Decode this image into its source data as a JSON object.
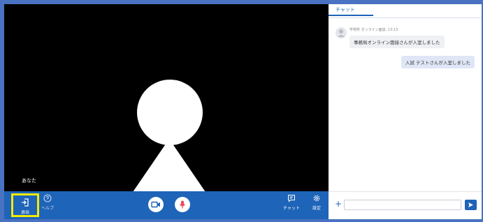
{
  "video": {
    "self_label": "あなた"
  },
  "controls": {
    "exit_label": "退出",
    "help_label": "ヘルプ",
    "chat_label": "チャット",
    "settings_label": "設定"
  },
  "chat": {
    "tab_label": "チャット",
    "messages": [
      {
        "meta": "学校所 オンライン面談, 13:13",
        "text": "事務局オンライン面接さんが入室しました"
      },
      {
        "text": "入試 テストさんが入室しました"
      }
    ],
    "add_label": "+"
  },
  "colors": {
    "accent": "#1e64b8",
    "highlight": "#f4ea00",
    "frame": "#4a72c2"
  }
}
